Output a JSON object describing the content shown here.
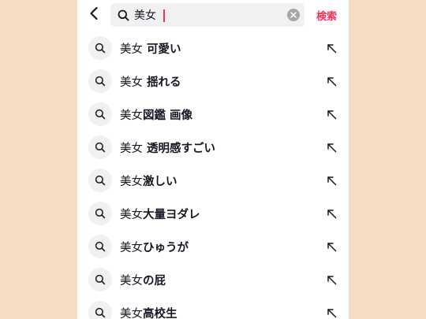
{
  "colors": {
    "background": "#f5dcc4",
    "accent": "#fe2c55",
    "text": "#161823",
    "field": "#f1f1f2"
  },
  "header": {
    "back_icon": "chevron-left-icon",
    "search": {
      "icon": "search-icon",
      "value": "美女",
      "clear_icon": "clear-icon"
    },
    "submit_label": "検索"
  },
  "suggestions": [
    {
      "prefix": "美女",
      "rest": " 可愛い"
    },
    {
      "prefix": "美女",
      "rest": " 揺れる"
    },
    {
      "prefix": "美女",
      "rest": "図鑑 画像"
    },
    {
      "prefix": "美女",
      "rest": " 透明感すごい"
    },
    {
      "prefix": "美女",
      "rest": "激しい"
    },
    {
      "prefix": "美女",
      "rest": "大量ヨダレ"
    },
    {
      "prefix": "美女",
      "rest": "ひゅうが"
    },
    {
      "prefix": "美女",
      "rest": "の屁"
    },
    {
      "prefix": "美女",
      "rest": "高校生"
    }
  ],
  "suggestion_icons": {
    "leading": "search-icon",
    "trailing": "arrow-up-left-icon"
  }
}
